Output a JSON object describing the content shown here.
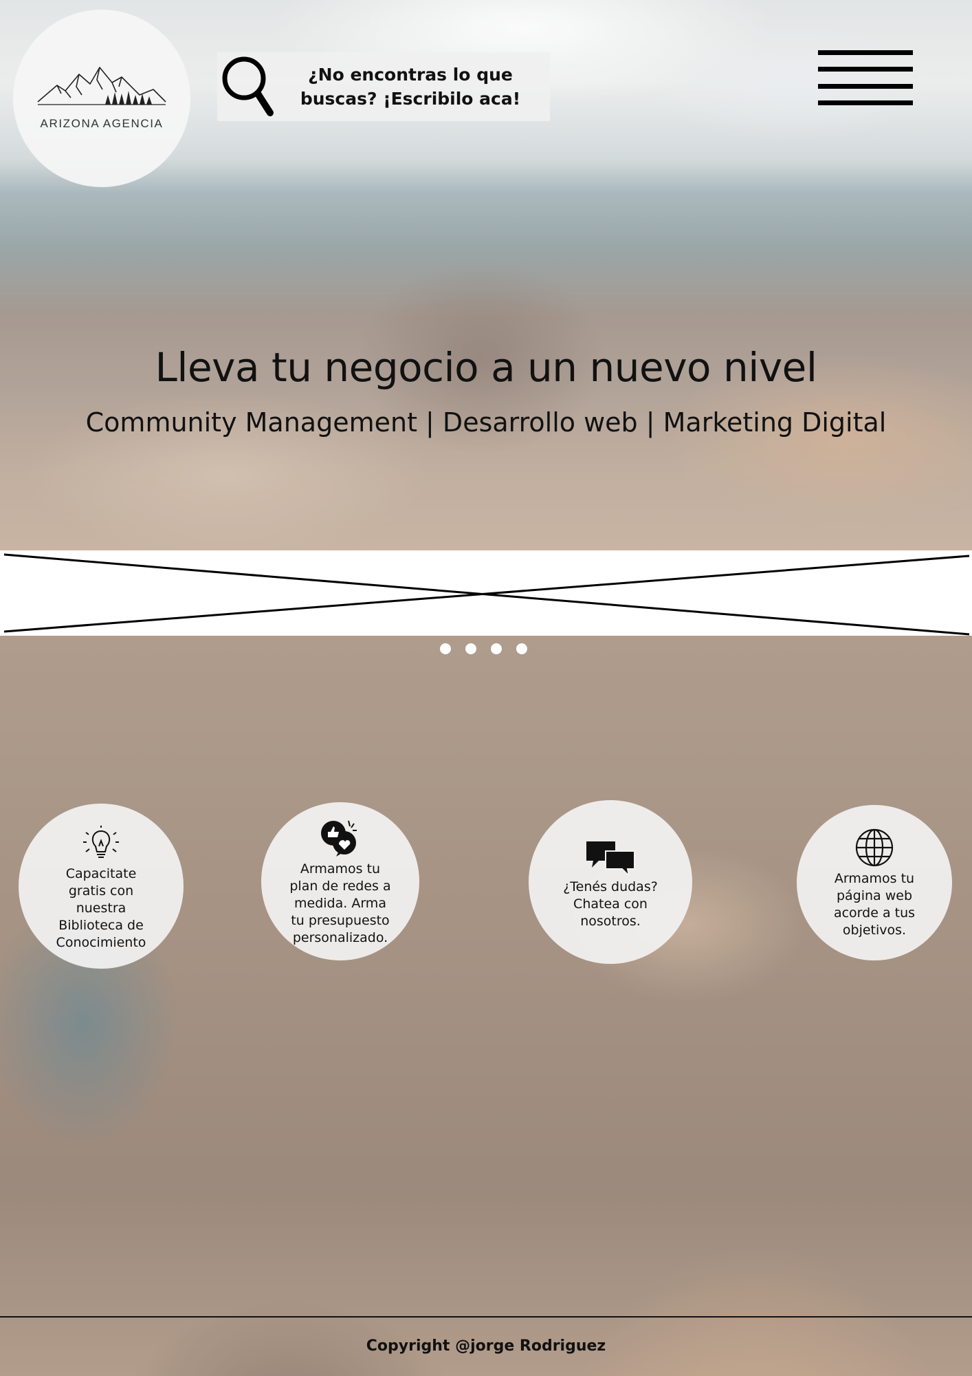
{
  "brand": {
    "logo_text": "ARIZONA AGENCIA"
  },
  "header": {
    "search_placeholder": "¿No encontras lo que buscas? ¡Escribilo aca!",
    "search_icon": "magnifier-icon",
    "menu_icon": "hamburger-menu-icon"
  },
  "hero": {
    "title": "Lleva tu negocio a un nuevo nivel",
    "subtitle": "Community Management | Desarrollo web | Marketing Digital"
  },
  "carousel": {
    "dot_count": 4
  },
  "services": [
    {
      "icon": "lightbulb-icon",
      "label": "Capacitate gratis con nuestra Biblioteca de Conocimiento"
    },
    {
      "icon": "social-media-icon",
      "label": "Armamos tu plan de redes a medida. Arma tu presupuesto personalizado."
    },
    {
      "icon": "chat-bubbles-icon",
      "label": "¿Tenés dudas? Chatea con nosotros."
    },
    {
      "icon": "globe-icon",
      "label": "Armamos tu página web acorde a tus objetivos."
    }
  ],
  "footer": {
    "copyright": "Copyright @jorge Rodriguez"
  }
}
